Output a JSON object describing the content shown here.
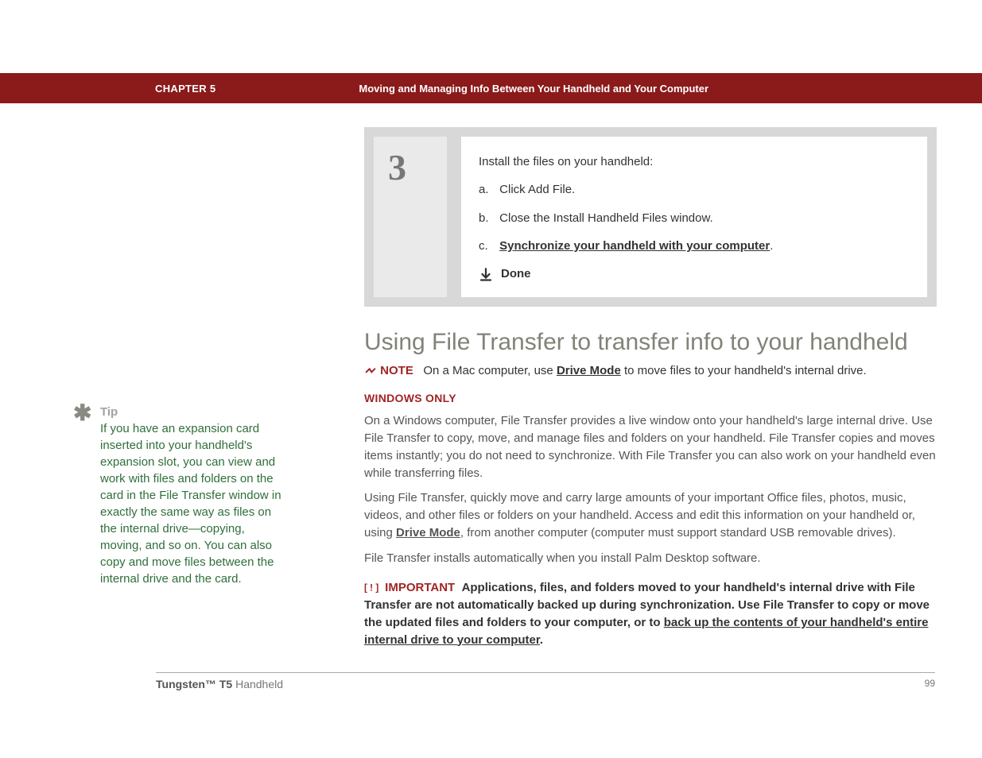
{
  "header": {
    "chapter": "CHAPTER 5",
    "title": "Moving and Managing Info Between Your Handheld and Your Computer"
  },
  "sidebar": {
    "tip_label": "Tip",
    "tip_body": "If you have an expansion card inserted into your handheld's expansion slot, you can view and work with files and folders on the card in the File Transfer window in exactly the same way as files on the internal drive—copying, moving, and so on. You can also copy and move files between the internal drive and the card."
  },
  "step": {
    "number": "3",
    "intro": "Install the files on your handheld:",
    "items": [
      {
        "letter": "a.",
        "text": "Click Add File."
      },
      {
        "letter": "b.",
        "text": "Close the Install Handheld Files window."
      },
      {
        "letter": "c.",
        "link": "Synchronize your handheld with your computer",
        "after": "."
      }
    ],
    "done": "Done"
  },
  "section": {
    "heading": "Using File Transfer to transfer info to your handheld",
    "note_label": "NOTE",
    "note_before": "On a Mac computer, use ",
    "note_link": "Drive Mode",
    "note_after": " to move files to your handheld's internal drive.",
    "windows_only": "WINDOWS ONLY",
    "p1": "On a Windows computer, File Transfer provides a live window onto your handheld's large internal drive. Use File Transfer to copy, move, and manage files and folders on your handheld. File Transfer copies and moves items instantly; you do not need to synchronize. With File Transfer you can also work on your handheld even while transferring files.",
    "p2_before": "Using File Transfer, quickly move and carry large amounts of your important Office files, photos, music, videos, and other files or folders on your handheld. Access and edit this information on your handheld or, using ",
    "p2_link": "Drive Mode",
    "p2_after": ", from another computer (computer must support standard USB removable drives).",
    "p3": "File Transfer installs automatically when you install Palm Desktop software.",
    "important_label": "IMPORTANT",
    "important_before": "Applications, files, and folders moved to your handheld's internal drive with File Transfer are not automatically backed up during synchronization. Use File Transfer to copy or move the updated files and folders to your computer, or to ",
    "important_link": "back up the contents of your handheld's entire internal drive to your computer",
    "important_after": "."
  },
  "footer": {
    "product_bold": "Tungsten™ T5",
    "product_rest": " Handheld",
    "page": "99"
  }
}
